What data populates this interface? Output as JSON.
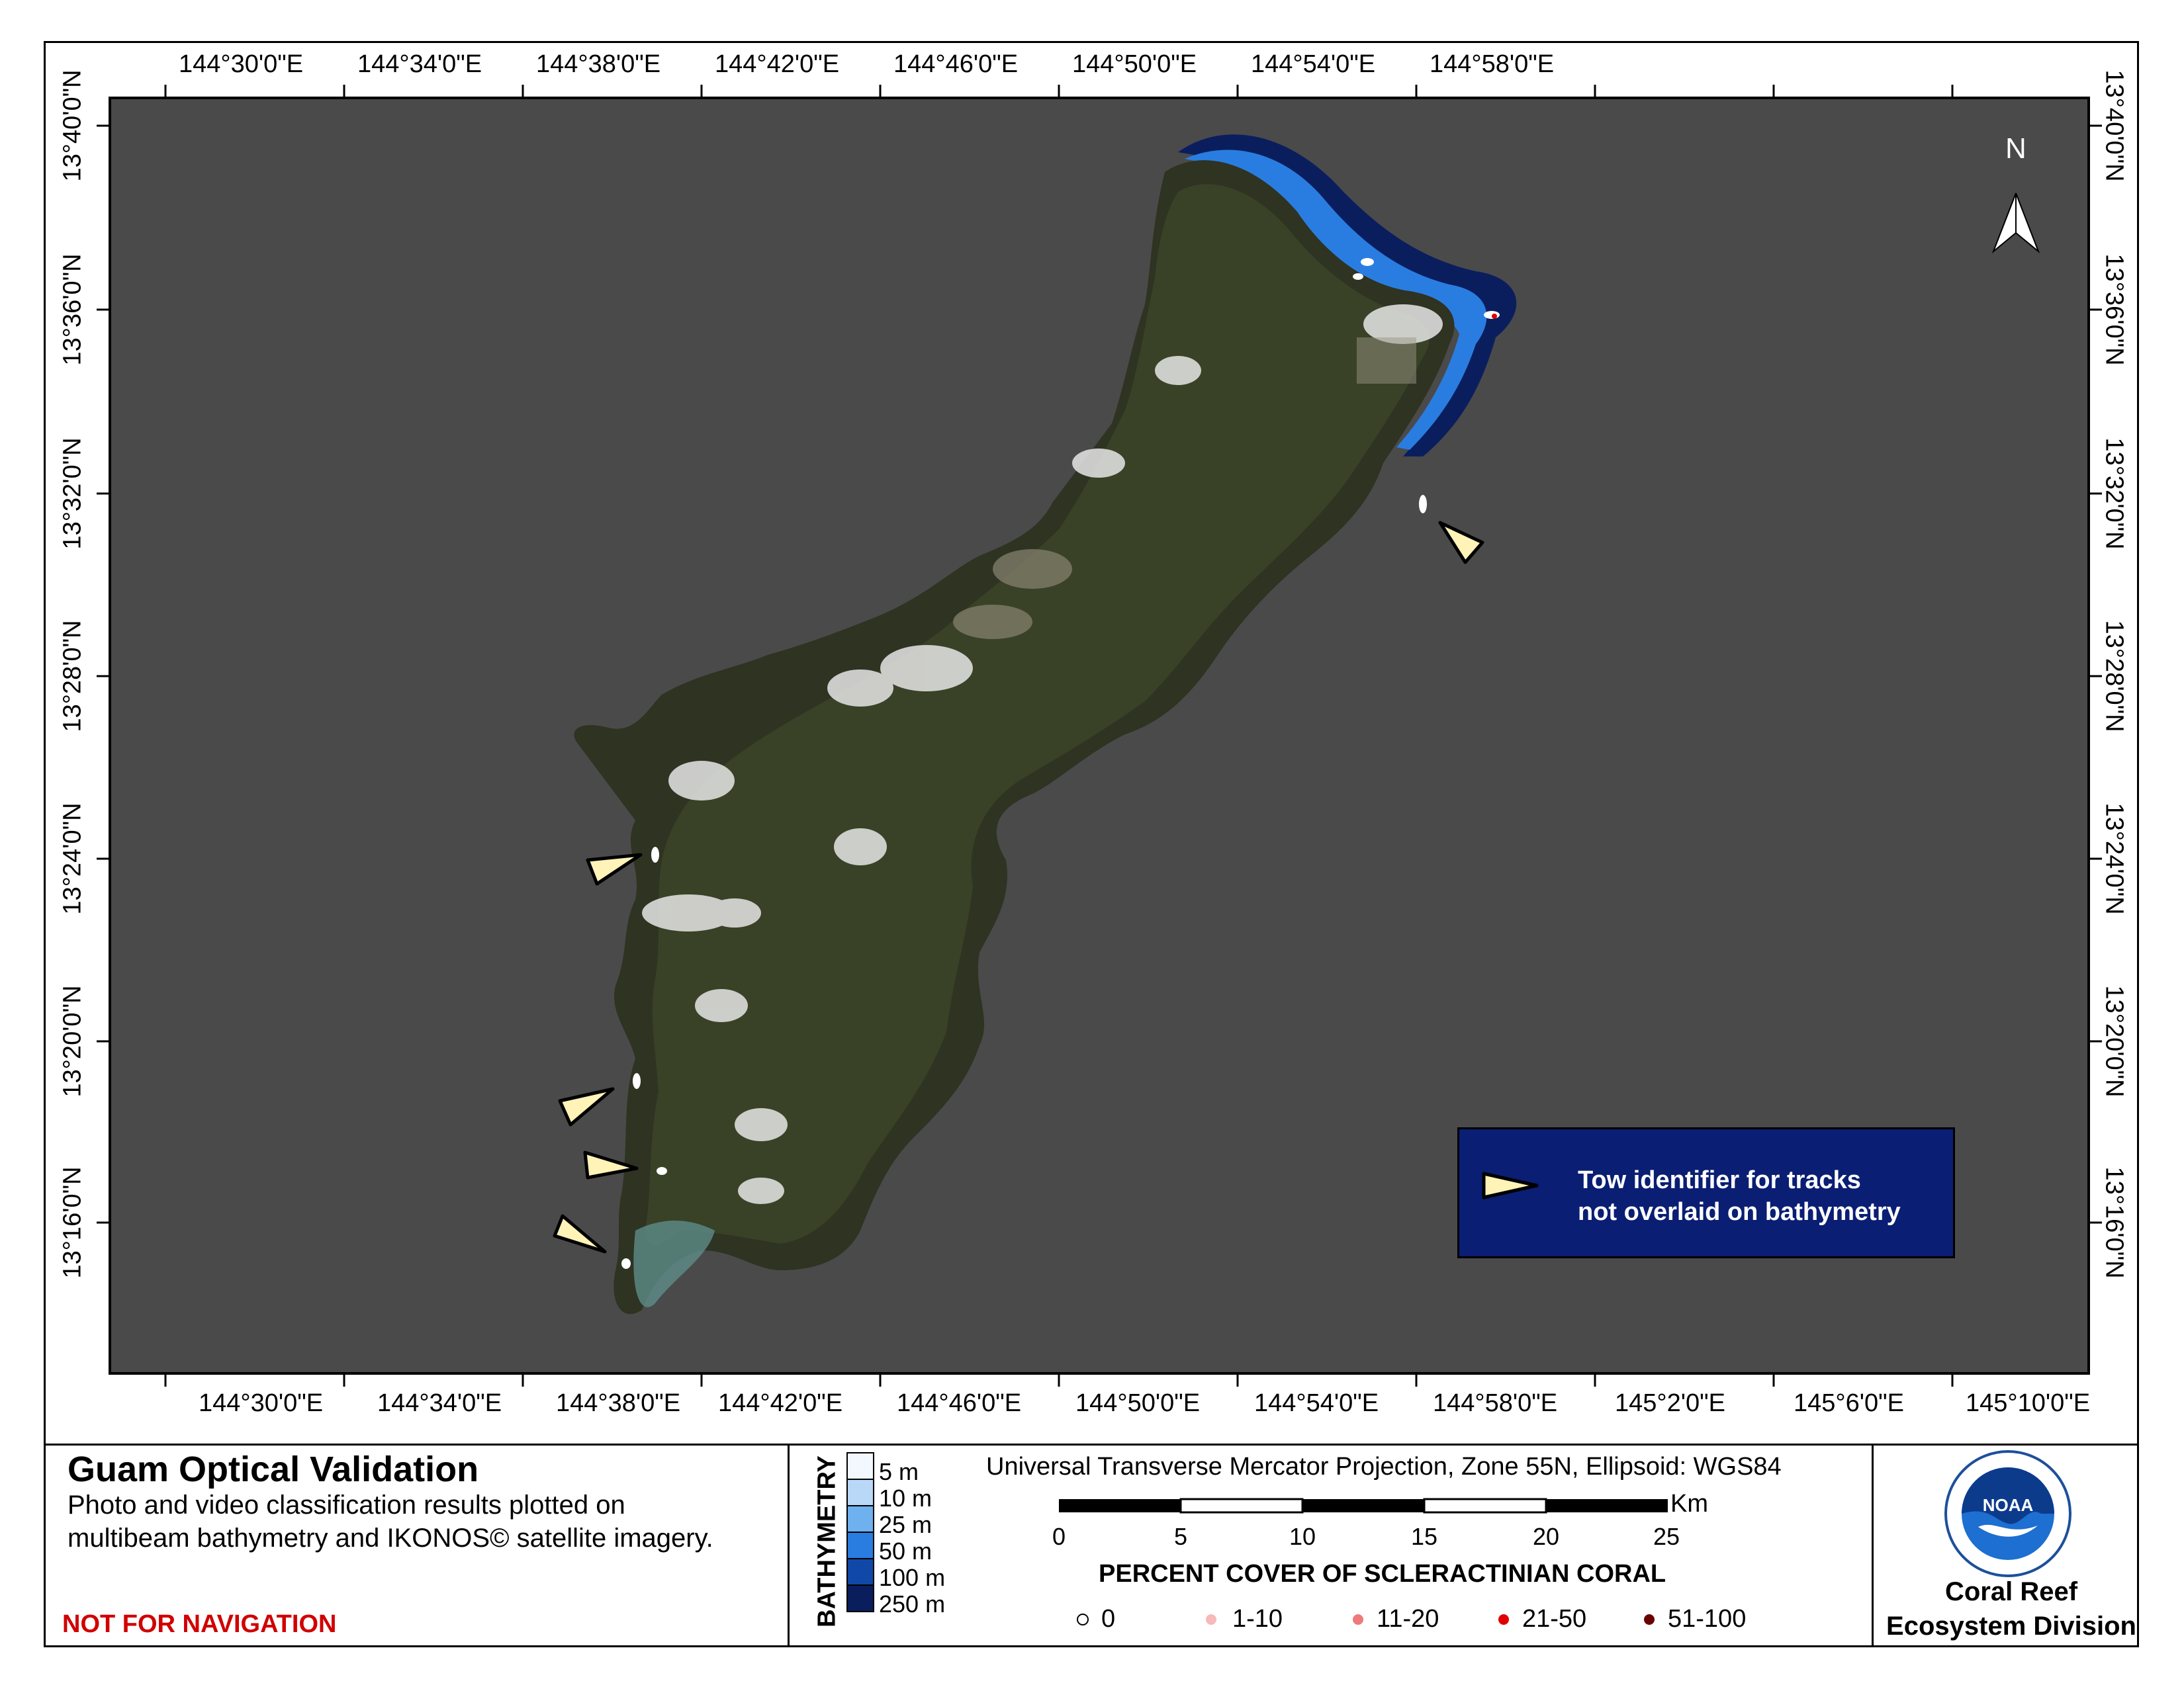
{
  "map": {
    "title": "Guam Optical Validation",
    "description": "Photo and video classification results plotted on multibeam bathymetry and IKONOS© satellite imagery.",
    "warning": "NOT FOR NAVIGATION",
    "north_label": "N",
    "projection": "Universal Transverse Mercator Projection, Zone 55N, Ellipsoid: WGS84",
    "agency": {
      "line1": "Coral Reef",
      "line2": "Ecosystem Division"
    },
    "colors": {
      "background": "#4a4a4a",
      "tow_box": "#0a1e73",
      "warning": "#d10000"
    }
  },
  "top_ticks": [
    "144°30'0\"E",
    "144°34'0\"E",
    "144°38'0\"E",
    "144°42'0\"E",
    "144°46'0\"E",
    "144°50'0\"E",
    "144°54'0\"E",
    "144°58'0\"E"
  ],
  "bottom_ticks": [
    "144°30'0\"E",
    "144°34'0\"E",
    "144°38'0\"E",
    "144°42'0\"E",
    "144°46'0\"E",
    "144°50'0\"E",
    "144°54'0\"E",
    "144°58'0\"E",
    "145°2'0\"E",
    "145°6'0\"E",
    "145°10'0\"E"
  ],
  "lat_ticks": [
    "13°40'0\"N",
    "13°36'0\"N",
    "13°32'0\"N",
    "13°28'0\"N",
    "13°24'0\"N",
    "13°20'0\"N",
    "13°16'0\"N"
  ],
  "bathymetry": {
    "title": "BATHYMETRY",
    "levels": [
      {
        "label": "5 m",
        "color": "#f3f8ff"
      },
      {
        "label": "10 m",
        "color": "#b9d8f8"
      },
      {
        "label": "25 m",
        "color": "#6fb0ef"
      },
      {
        "label": "50 m",
        "color": "#2a7de0"
      },
      {
        "label": "100 m",
        "color": "#1048a8"
      },
      {
        "label": "250 m",
        "color": "#0a1e5e"
      }
    ]
  },
  "scale_bar": {
    "unit": "Km",
    "labels": [
      "0",
      "5",
      "10",
      "15",
      "20",
      "25"
    ]
  },
  "coral_legend": {
    "title": "PERCENT COVER OF SCLERACTINIAN CORAL",
    "classes": [
      {
        "label": "0",
        "color": "#ffffff"
      },
      {
        "label": "1-10",
        "color": "#f7b9b9"
      },
      {
        "label": "11-20",
        "color": "#ee7a7a"
      },
      {
        "label": "21-50",
        "color": "#e00000"
      },
      {
        "label": "51-100",
        "color": "#6a0000"
      }
    ]
  },
  "tow_legend": {
    "line1": "Tow identifier for tracks",
    "line2": "not overlaid on bathymetry"
  }
}
